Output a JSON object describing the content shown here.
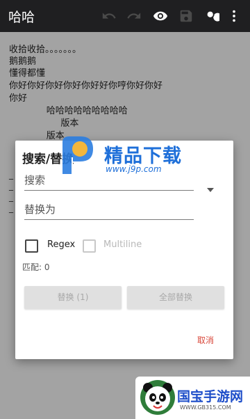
{
  "app": {
    "title": "哈哈"
  },
  "toolbar": {
    "icons": [
      "undo-icon",
      "redo-icon",
      "eye-icon",
      "save-icon",
      "search-icon",
      "more-vert-icon"
    ]
  },
  "editor": {
    "lines": [
      "收拾收拾。。。。。。。",
      "鹅鹅鹅",
      "懂得都懂",
      "你好你好你好你好你好好你哼你好你好",
      "你好",
      "             哈哈哈哈哈哈哈哈哈",
      "                  版本",
      "             版本"
    ],
    "dash_lines": [
      "_",
      "_",
      "_",
      "_"
    ]
  },
  "dialog": {
    "title": "搜索/替换",
    "search_placeholder": "搜索",
    "replace_placeholder": "替换为",
    "regex_label": "Regex",
    "multiline_label": "Multiline",
    "match_text": "匹配: 0",
    "replace_button": "替换 (1)",
    "replace_all_button": "全部替换",
    "cancel_button": "取消"
  },
  "watermarks": {
    "j9p": {
      "title": "精品下载",
      "url": "www.j9p.com"
    },
    "gb": {
      "title": "国宝手游网",
      "url": "WWW.GB315.COM"
    }
  }
}
